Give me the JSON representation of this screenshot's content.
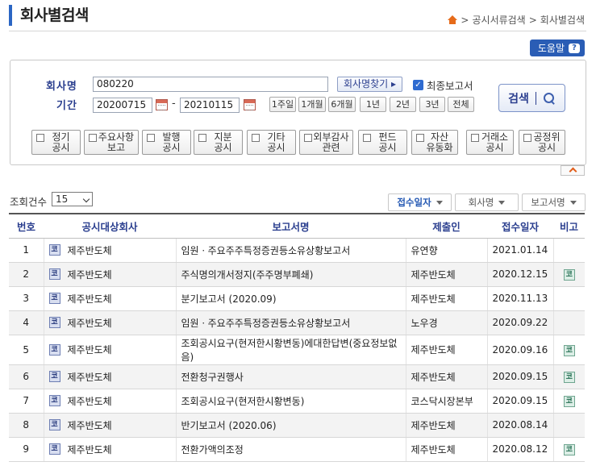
{
  "page": {
    "title": "회사별검색",
    "breadcrumb": [
      "공시서류검색",
      "회사별검색"
    ],
    "help_label": "도움말"
  },
  "search": {
    "company_label": "회사명",
    "company_value": "080220",
    "find_company_label": "회사명찾기 ▸",
    "final_report_label": "최종보고서",
    "final_report_checked": true,
    "period_label": "기간",
    "start_date": "20200715",
    "end_date": "20210115",
    "period_dash": "-",
    "period_buttons": [
      "1주일",
      "1개월",
      "6개월",
      "1년",
      "2년",
      "3년",
      "전체"
    ],
    "search_button_label": "검색"
  },
  "filters": [
    {
      "label": "정기\n공시"
    },
    {
      "label": "주요사항\n보고"
    },
    {
      "label": "발행\n공시"
    },
    {
      "label": "지분\n공시"
    },
    {
      "label": "기타\n공시"
    },
    {
      "label": "외부감사\n관련"
    },
    {
      "label": "펀드\n공시"
    },
    {
      "label": "자산\n유동화"
    },
    {
      "label": "거래소\n공시"
    },
    {
      "label": "공정위\n공시"
    }
  ],
  "list": {
    "count_label": "조회건수",
    "count_value": "15",
    "sort_buttons": [
      "접수일자",
      "회사명",
      "보고서명"
    ],
    "columns": [
      "번호",
      "공시대상회사",
      "보고서명",
      "제출인",
      "접수일자",
      "비고"
    ],
    "rows": [
      {
        "no": "1",
        "badge": "코",
        "company": "제주반도체",
        "report": "임원ㆍ주요주주특정증권등소유상황보고서",
        "submitter": "유연향",
        "date": "2021.01.14",
        "note": ""
      },
      {
        "no": "2",
        "badge": "코",
        "company": "제주반도체",
        "report": "주식명의개서정지(주주명부폐쇄)",
        "submitter": "제주반도체",
        "date": "2020.12.15",
        "note": "코"
      },
      {
        "no": "3",
        "badge": "코",
        "company": "제주반도체",
        "report": "분기보고서 (2020.09)",
        "submitter": "제주반도체",
        "date": "2020.11.13",
        "note": ""
      },
      {
        "no": "4",
        "badge": "코",
        "company": "제주반도체",
        "report": "임원ㆍ주요주주특정증권등소유상황보고서",
        "submitter": "노우경",
        "date": "2020.09.22",
        "note": ""
      },
      {
        "no": "5",
        "badge": "코",
        "company": "제주반도체",
        "report": "조회공시요구(현저한시황변동)에대한답변(중요정보없음)",
        "submitter": "제주반도체",
        "date": "2020.09.16",
        "note": "코"
      },
      {
        "no": "6",
        "badge": "코",
        "company": "제주반도체",
        "report": "전환청구권행사",
        "submitter": "제주반도체",
        "date": "2020.09.15",
        "note": "코"
      },
      {
        "no": "7",
        "badge": "코",
        "company": "제주반도체",
        "report": "조회공시요구(현저한시황변동)",
        "submitter": "코스닥시장본부",
        "date": "2020.09.15",
        "note": "코"
      },
      {
        "no": "8",
        "badge": "코",
        "company": "제주반도체",
        "report": "반기보고서 (2020.06)",
        "submitter": "제주반도체",
        "date": "2020.08.14",
        "note": ""
      },
      {
        "no": "9",
        "badge": "코",
        "company": "제주반도체",
        "report": "전환가액의조정",
        "submitter": "제주반도체",
        "date": "2020.08.12",
        "note": "코"
      }
    ]
  }
}
